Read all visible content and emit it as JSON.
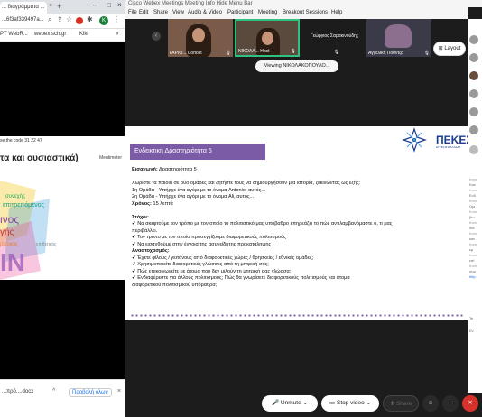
{
  "browser": {
    "tab_title": "... διαγράμματα ...",
    "tab_close": "×",
    "new_tab": "+",
    "window_min": "–",
    "window_max": "□",
    "window_close": "×",
    "address": "...6f3af339497a...",
    "profile_initial": "K",
    "bookmarks": [
      "PT WebR...",
      "webex.sch.gr",
      "Kiki"
    ],
    "bookmarks_more": "»",
    "code_line": "se the code 31 22 47",
    "slide_title": "τα και ουσιαστικά)",
    "menti_logo": "Mentimeter",
    "cloud_words": [
      "συνεχής",
      "επιτρεπόμενος",
      "ινος",
      "γής",
      "ρατικός",
      "επιθετικός",
      "IN"
    ],
    "download_item": "...πρό....docx",
    "download_chevron": "^",
    "download_showall": "Προβολή όλων",
    "download_close": "×"
  },
  "webex": {
    "title": "Cisco Webex Meetings  Meeting Info  Hide Menu Bar",
    "menus": [
      "File",
      "Edit",
      "Share",
      "View",
      "Audio & Video",
      "Participant",
      "Meeting",
      "Breakout Sessions",
      "Help"
    ],
    "prev_icon": "‹",
    "thumbnails": [
      {
        "label": "ΓΑΡΙΟ... Cohost"
      },
      {
        "label": "ΝΙΚΟΛΑ... Host"
      },
      {
        "label": "Γεώργιος Σαρακινούδης"
      },
      {
        "label": "Αγγελική Πούντζα"
      }
    ],
    "layout_label": "Layout",
    "viewing_label": "Viewing ΝΙΚΟΛΑΚΟΠΟΥΛΟ...",
    "activity": {
      "header": "Ενδεικτική Δραστηριότητα 5",
      "logo_text": "ΠΕΚΕΣ",
      "logo_sub": "ΔΥΤΙΚΗΣ ΕΛΛΑΔΑΣ",
      "lines": [
        {
          "bold": "Εισαγωγή:",
          "text": " Δραστηριότητα 5"
        },
        {
          "bold": "",
          "text": ""
        },
        {
          "bold": "",
          "text": "Χωρίστε τα παιδιά σε δύο ομάδες και ζητήστε τους να δημιουργήσουν μια ιστορία, ξεκινώντας ως εξής:"
        },
        {
          "bold": "",
          "text": "1η Ομάδα - Υπήρχε ένα αγόρι με το όνομα Antonio, αυτός..."
        },
        {
          "bold": "",
          "text": "2η Ομάδα - Υπήρχε ένα αγόρι με το όνομα Ali, αυτός..."
        },
        {
          "bold": "Χρόνος:",
          "text": " 15 λεπτά"
        },
        {
          "bold": "",
          "text": ""
        },
        {
          "bold": "Στόχοι:",
          "text": ""
        },
        {
          "bold": "",
          "text": "✔ Να σκεφτούμε τον τρόπο με τον οποίο το πολιτιστικό μας υπόβαθρο επηρεάζει το πώς αντιλαμβανόμαστε ό, τι μας"
        },
        {
          "bold": "",
          "text": "    περιβάλλει."
        },
        {
          "bold": "",
          "text": "✔ Τον τρόπο με τον οποίο προσεγγίζουμε διαφορετικούς πολιτισμούς"
        },
        {
          "bold": "",
          "text": "✔ Να εισαχθούμε στην έννοια της ασυνείδητης προκατάληψης"
        },
        {
          "bold": "Αναστοχασμός:",
          "text": ""
        },
        {
          "bold": "",
          "text": "✔ Έχετε φίλους / γειτόνους από διαφορετικές χώρες / θρησκείες / εθνικές ομάδες;"
        },
        {
          "bold": "",
          "text": "✔ Χρησιμοποιείτε διαφορετικές γλώσσες από τη μητρική σας;"
        },
        {
          "bold": "",
          "text": "✔ Πώς επικοινωνείτε με άτομα που δεν μιλούν τη μητρική σας γλώσσα;"
        },
        {
          "bold": "",
          "text": "✔ Ενδιαφέρεστε για άλλους πολιτισμούς; Πώς θα γνωρίσετε διαφορετικούς πολιτισμούς και άτομα"
        },
        {
          "bold": "",
          "text": "    διαφορετικού πολιτισμικού υπόβαθρα;"
        }
      ]
    },
    "controls": {
      "unmute": "🎤 Unmute ⌄",
      "stop_video": "▭ Stop video ⌄",
      "share": "⬆ Share",
      "reactions": "☺",
      "more": "···",
      "leave": "✕"
    }
  },
  "panel": {
    "chat_lines": [
      "from",
      "Kav",
      "from",
      "Ενδ",
      "from",
      "Ομι",
      "from",
      "βιω",
      "from",
      "διά",
      "from",
      "καν",
      "from",
      "εμ",
      "from",
      "επί",
      "from",
      "συμ",
      "http"
    ],
    "footer_text": "Te",
    "footer_text_2": "Ev"
  },
  "colors": {
    "accent_purple": "#7b5aa6",
    "leave_red": "#d6332c",
    "active_speaker_green": "#2ec27e"
  }
}
